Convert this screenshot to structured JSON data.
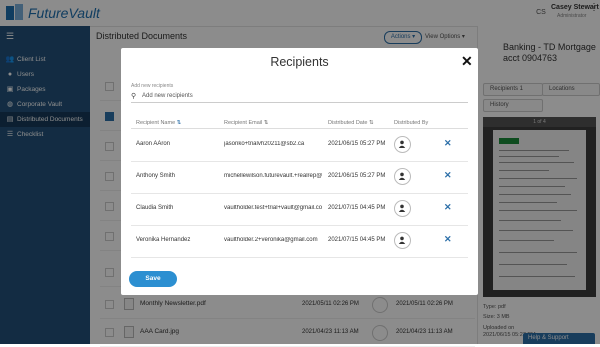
{
  "app": {
    "logo_text": "FutureVault",
    "user_initials": "CS",
    "user_name": "Casey Stewart",
    "user_role": "Administrator",
    "accent": "#2c6fa8"
  },
  "sidebar": {
    "items": [
      {
        "label": "Client List",
        "icon": "users-icon"
      },
      {
        "label": "Users",
        "icon": "user-icon"
      },
      {
        "label": "Packages",
        "icon": "package-icon"
      },
      {
        "label": "Corporate Vault",
        "icon": "globe-icon"
      },
      {
        "label": "Distributed Documents",
        "icon": "briefcase-icon",
        "active": true
      },
      {
        "label": "Checklist",
        "icon": "checklist-icon"
      }
    ]
  },
  "main": {
    "title": "Distributed Documents",
    "actions_label": "Actions ▾",
    "view_options_label": "View Options ▾",
    "rows": [
      {
        "name": "Monthly Newsletter.pdf",
        "date1": "2021/05/11 02:26 PM",
        "date2": "2021/05/11 02:26 PM"
      },
      {
        "name": "AAA Card.jpg",
        "date1": "2021/04/23 11:13 AM",
        "date2": "2021/04/23 11:13 AM"
      }
    ]
  },
  "right_panel": {
    "title": "Banking - TD Mortgage acct 0904763",
    "chips": [
      "Recipients 1",
      "Locations",
      "History"
    ],
    "page_indicator": "1 of 4",
    "type": "Type: pdf",
    "size": "Size: 3 MB",
    "uploaded_label": "Uploaded on",
    "uploaded_on": "2021/06/15 05:27 PM"
  },
  "help_label": "Help & Support",
  "modal": {
    "title": "Recipients",
    "add_label": "Add new recipients",
    "add_placeholder": "Add new recipients",
    "columns": [
      "Recipient Name",
      "Recipient Email",
      "Distributed Date",
      "Distributed By"
    ],
    "recipients": [
      {
        "name": "Aaron AAron",
        "email": "jasonko+trialvh20211@sb2.ca",
        "date": "2021/06/15 05:27 PM"
      },
      {
        "name": "Anthony Smith",
        "email": "michellewilson.futurevault.+realrep@gmail.com",
        "date": "2021/06/15 05:27 PM"
      },
      {
        "name": "Claudia Smith",
        "email": "vaultholder.test+trial+vault@gmail.com",
        "date": "2021/07/15 04:45 PM"
      },
      {
        "name": "Veronika Hernandez",
        "email": "vaultholder.2+veronika@gmail.com",
        "date": "2021/07/15 04:45 PM"
      }
    ],
    "save_label": "Save"
  }
}
